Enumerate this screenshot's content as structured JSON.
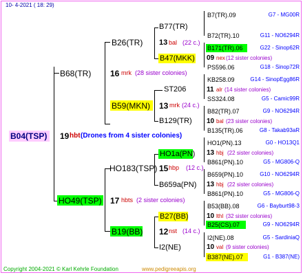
{
  "header": "10-   4-2021  (  18:  29)",
  "footer_left": "Copyright 2004-2021 © Karl Kehrle Foundation",
  "footer_right": "www.pedigreeapis.org",
  "root": {
    "name": "B04(TSP)",
    "num": "19",
    "abbr": "hbt",
    "note": "(Drones from 4 sister colonies)"
  },
  "g1": [
    {
      "name": "B68(TR)",
      "num": "16",
      "abbr": "mrk",
      "note": "(28 sister colonies)"
    },
    {
      "name": "HO49(TSP)",
      "num": "17",
      "abbr": "hbts",
      "note": "(2 sister colonies)"
    }
  ],
  "g2": [
    {
      "name": "B26(TR)"
    },
    {
      "name": "B59(MKN)",
      "num": "13",
      "abbr": "mrk",
      "note": "(24 c.)"
    },
    {
      "name": "HO183(TSP)",
      "num": "15",
      "abbr": "hbp",
      "note": "(12 c.)"
    },
    {
      "name": "B19(BB)",
      "num": "12",
      "abbr": "nst",
      "note": "(14 c.)"
    }
  ],
  "g3": [
    {
      "name": "B77(TR)",
      "num": "13",
      "abbr": "bal",
      "note": "(22 c.)"
    },
    {
      "name": "B47(MKK)",
      "num": "09",
      "abbr": "nex",
      "note": "(12 sister colonies)"
    },
    {
      "name": "ST206",
      "num": "11",
      "abbr": "alr",
      "note": "(14 sister colonies)"
    },
    {
      "name": "B129(TR)",
      "num": "10",
      "abbr": "bal",
      "note": "(23 sister colonies)"
    },
    {
      "name": "HO1a(PN)",
      "num": "13",
      "abbr": "hbj",
      "note": "(22 sister colonies)"
    },
    {
      "name": "B659a(PN)",
      "num": "13",
      "abbr": "hbj",
      "note": "(22 sister colonies)"
    },
    {
      "name": "B27(BB)",
      "num": "10",
      "abbr": "lthl",
      "note": "(32 sister colonies)"
    },
    {
      "name": "I2(NE)",
      "num": "10",
      "abbr": "val",
      "note": "(9 sister colonies)"
    }
  ],
  "g4": [
    {
      "name": "B7(TR).09",
      "info": "G7 - MG00R"
    },
    {
      "name": "B72(TR).10",
      "info": "G11 - NO6294R"
    },
    {
      "name": "B171(TR).06",
      "info": "G22 - Sinop62R"
    },
    {
      "name": "PS596.06",
      "info": "G18 - Sinop72R"
    },
    {
      "name": "KB258.09",
      "info": "G14 - SinopEgg86R"
    },
    {
      "name": "SS324.08",
      "info": "G5 - Camic99R"
    },
    {
      "name": "B82(TR).07",
      "info": "G9 - NO6294R"
    },
    {
      "name": "B135(TR).06",
      "info": "G8 - Takab93aR"
    },
    {
      "name": "HO1(PN).13",
      "info": "G0 - HO13Q1"
    },
    {
      "name": "B861(PN).10",
      "info": "G5 - MG806-Q"
    },
    {
      "name": "B659(PN).10",
      "info": "G10 - NO6294R"
    },
    {
      "name": "B861(PN).10",
      "info": "G5 - MG806-Q"
    },
    {
      "name": "B53(BB).08",
      "info": "G6 - Bayburt98-3"
    },
    {
      "name": "B25(CS).07",
      "info": "G9 - NO6294R"
    },
    {
      "name": "I2(NE).08",
      "info": "G5 - SardiniaQ"
    },
    {
      "name": "B387(NE).07",
      "info": "G1 - B387(NE)"
    }
  ]
}
